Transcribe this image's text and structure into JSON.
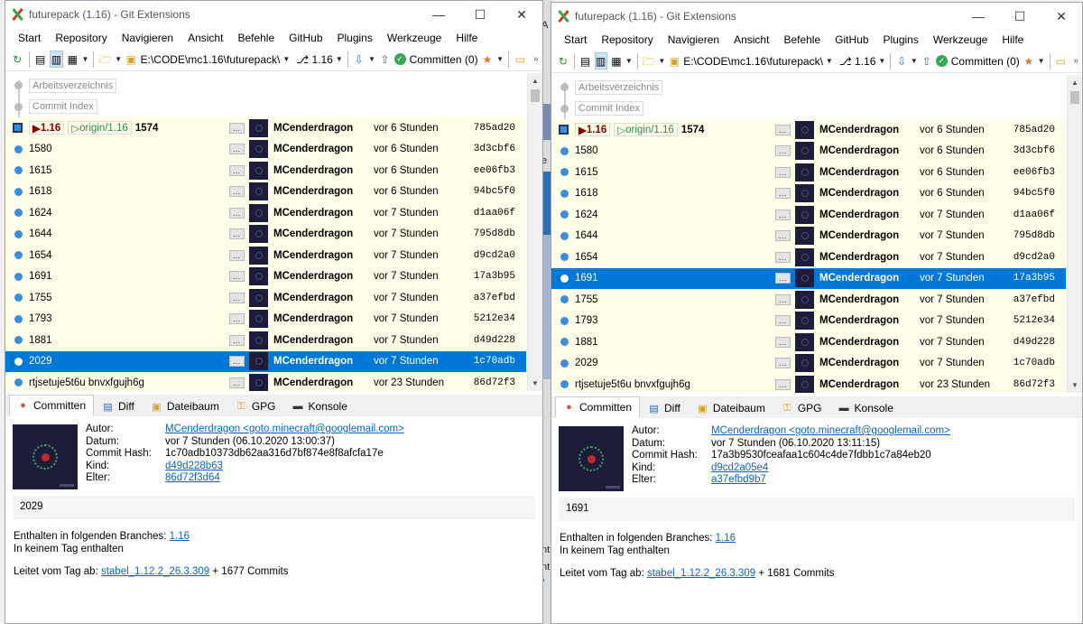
{
  "windows": [
    {
      "id": "w1",
      "title": "futurepack (1.16) - Git Extensions",
      "menu": [
        "Start",
        "Repository",
        "Navigieren",
        "Ansicht",
        "Befehle",
        "GitHub",
        "Plugins",
        "Werkzeuge",
        "Hilfe"
      ],
      "toolbar": {
        "path": "E:\\CODE\\mc1.16\\futurepack\\",
        "branch": "1.16",
        "commit_label": "Committen (0)",
        "overflow": "»"
      },
      "work_items": [
        "Arbeitsverzeichnis",
        "Commit Index"
      ],
      "head_row": {
        "local_branch": "1.16",
        "remote_branch": "origin/1.16",
        "message": "1574",
        "author": "MCenderdragon",
        "date": "vor 6 Stunden",
        "hash": "785ad20"
      },
      "rows": [
        {
          "message": "1580",
          "author": "MCenderdragon",
          "date": "vor 6 Stunden",
          "hash": "3d3cbf6"
        },
        {
          "message": "1615",
          "author": "MCenderdragon",
          "date": "vor 6 Stunden",
          "hash": "ee06fb3"
        },
        {
          "message": "1618",
          "author": "MCenderdragon",
          "date": "vor 6 Stunden",
          "hash": "94bc5f0"
        },
        {
          "message": "1624",
          "author": "MCenderdragon",
          "date": "vor 7 Stunden",
          "hash": "d1aa06f"
        },
        {
          "message": "1644",
          "author": "MCenderdragon",
          "date": "vor 7 Stunden",
          "hash": "795d8db"
        },
        {
          "message": "1654",
          "author": "MCenderdragon",
          "date": "vor 7 Stunden",
          "hash": "d9cd2a0"
        },
        {
          "message": "1691",
          "author": "MCenderdragon",
          "date": "vor 7 Stunden",
          "hash": "17a3b95"
        },
        {
          "message": "1755",
          "author": "MCenderdragon",
          "date": "vor 7 Stunden",
          "hash": "a37efbd"
        },
        {
          "message": "1793",
          "author": "MCenderdragon",
          "date": "vor 7 Stunden",
          "hash": "5212e34"
        },
        {
          "message": "1881",
          "author": "MCenderdragon",
          "date": "vor 7 Stunden",
          "hash": "d49d228"
        },
        {
          "message": "2029",
          "author": "MCenderdragon",
          "date": "vor 7 Stunden",
          "hash": "1c70adb"
        },
        {
          "message": "rtjsetuje5t6u bnvxfgujh6g",
          "author": "MCenderdragon",
          "date": "vor 23 Stunden",
          "hash": "86d72f3"
        }
      ],
      "tabs": [
        "Committen",
        "Diff",
        "Dateibaum",
        "GPG",
        "Konsole"
      ],
      "details": {
        "labels": [
          "Autor:",
          "Datum:",
          "Commit Hash:",
          "Kind:",
          "Elter:"
        ],
        "author": "MCenderdragon <goto.minecraft@googlemail.com>",
        "date": "vor 7 Stunden (06.10.2020 13:00:37)",
        "hash": "1c70adb10373db62aa316d7bf874e8f8afcfa17e",
        "child": "d49d228b63",
        "parent": "86d72f3d64",
        "message": "2029",
        "branches_label": "Enthalten in folgenden Branches:",
        "branches_value": "1.16",
        "no_tag": "In keinem Tag enthalten",
        "derived_label": "Leitet vom Tag ab:",
        "derived_tag": "stabel_1.12.2_26.3.309",
        "derived_suffix": "+ 1677 Commits"
      }
    },
    {
      "id": "w2",
      "title": "futurepack (1.16) - Git Extensions",
      "menu": [
        "Start",
        "Repository",
        "Navigieren",
        "Ansicht",
        "Befehle",
        "GitHub",
        "Plugins",
        "Werkzeuge",
        "Hilfe"
      ],
      "toolbar": {
        "path": "E:\\CODE\\mc1.16\\futurepack\\",
        "branch": "1.16",
        "commit_label": "Committen (0)",
        "overflow": "»"
      },
      "work_items": [
        "Arbeitsverzeichnis",
        "Commit Index"
      ],
      "head_row": {
        "local_branch": "1.16",
        "remote_branch": "origin/1.16",
        "message": "1574",
        "author": "MCenderdragon",
        "date": "vor 6 Stunden",
        "hash": "785ad20"
      },
      "rows": [
        {
          "message": "1580",
          "author": "MCenderdragon",
          "date": "vor 6 Stunden",
          "hash": "3d3cbf6"
        },
        {
          "message": "1615",
          "author": "MCenderdragon",
          "date": "vor 6 Stunden",
          "hash": "ee06fb3"
        },
        {
          "message": "1618",
          "author": "MCenderdragon",
          "date": "vor 6 Stunden",
          "hash": "94bc5f0"
        },
        {
          "message": "1624",
          "author": "MCenderdragon",
          "date": "vor 7 Stunden",
          "hash": "d1aa06f"
        },
        {
          "message": "1644",
          "author": "MCenderdragon",
          "date": "vor 7 Stunden",
          "hash": "795d8db"
        },
        {
          "message": "1654",
          "author": "MCenderdragon",
          "date": "vor 7 Stunden",
          "hash": "d9cd2a0"
        },
        {
          "message": "1691",
          "author": "MCenderdragon",
          "date": "vor 7 Stunden",
          "hash": "17a3b95"
        },
        {
          "message": "1755",
          "author": "MCenderdragon",
          "date": "vor 7 Stunden",
          "hash": "a37efbd"
        },
        {
          "message": "1793",
          "author": "MCenderdragon",
          "date": "vor 7 Stunden",
          "hash": "5212e34"
        },
        {
          "message": "1881",
          "author": "MCenderdragon",
          "date": "vor 7 Stunden",
          "hash": "d49d228"
        },
        {
          "message": "2029",
          "author": "MCenderdragon",
          "date": "vor 7 Stunden",
          "hash": "1c70adb"
        },
        {
          "message": "rtjsetuje5t6u bnvxfgujh6g",
          "author": "MCenderdragon",
          "date": "vor 23 Stunden",
          "hash": "86d72f3"
        }
      ],
      "tabs": [
        "Committen",
        "Diff",
        "Dateibaum",
        "GPG",
        "Konsole"
      ],
      "details": {
        "labels": [
          "Autor:",
          "Datum:",
          "Commit Hash:",
          "Kind:",
          "Elter:"
        ],
        "author": "MCenderdragon <goto.minecraft@googlemail.com>",
        "date": "vor 7 Stunden (06.10.2020 13:11:15)",
        "hash": "17a3b9530fceafaa1c604c4de7fdbb1c7a84eb20",
        "child": "d9cd2a05e4",
        "parent": "a37efbd9b7",
        "message": "1691",
        "branches_label": "Enthalten in folgenden Branches:",
        "branches_value": "1.16",
        "no_tag": "In keinem Tag enthalten",
        "derived_label": "Leitet vom Tag ab:",
        "derived_tag": "stabel_1.12.2_26.3.309",
        "derived_suffix": "+ 1681 Commits"
      }
    }
  ],
  "desktop_letters": [
    "A",
    "e",
    "nt",
    "nt",
    "/"
  ],
  "colors": {
    "selection": "#0078d7",
    "yellow_rows": "#fefde8",
    "graph": "#3b8ed9",
    "local_branch": "#8b0000",
    "remote_branch": "#2e8b57",
    "link": "#0b63c5"
  }
}
